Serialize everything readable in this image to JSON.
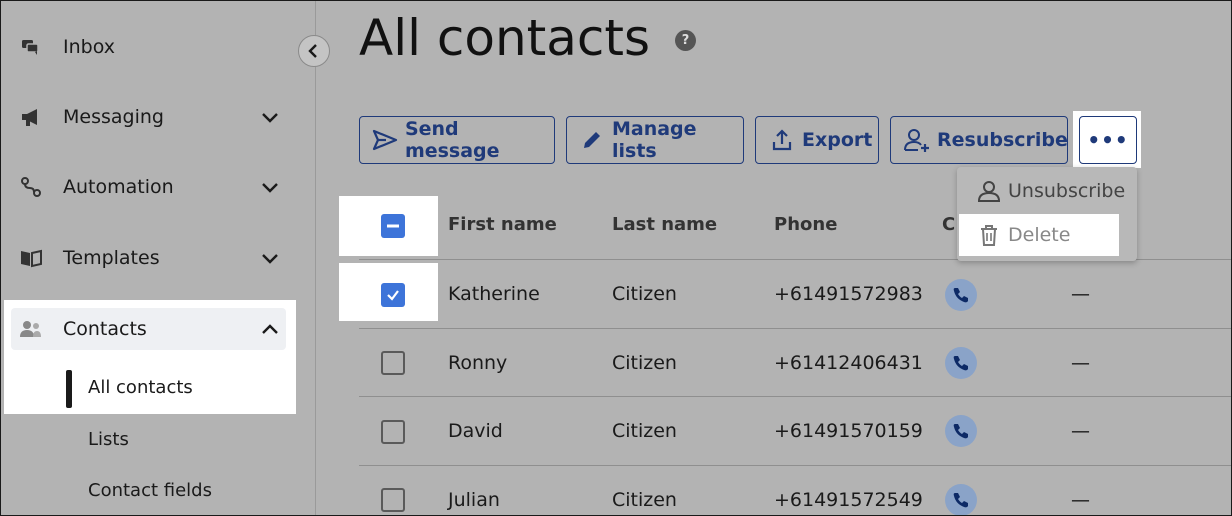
{
  "sidebar": {
    "items": [
      {
        "label": "Inbox",
        "icon": "chat-icon",
        "expandable": false
      },
      {
        "label": "Messaging",
        "icon": "megaphone-icon",
        "expandable": true
      },
      {
        "label": "Automation",
        "icon": "flow-icon",
        "expandable": true
      },
      {
        "label": "Templates",
        "icon": "book-icon",
        "expandable": true
      },
      {
        "label": "Contacts",
        "icon": "people-icon",
        "expandable": true,
        "expanded": true
      }
    ],
    "subitems": [
      {
        "label": "All contacts",
        "active": true
      },
      {
        "label": "Lists",
        "active": false
      },
      {
        "label": "Contact fields",
        "active": false
      }
    ],
    "collapse_icon": "chevron-left-icon"
  },
  "page": {
    "title": "All contacts",
    "help_glyph": "?"
  },
  "toolbar": {
    "send_message": "Send message",
    "manage_lists": "Manage lists",
    "export": "Export",
    "resubscribe": "Resubscribe",
    "more": "•••"
  },
  "dropdown": {
    "unsubscribe": "Unsubscribe",
    "delete": "Delete"
  },
  "table": {
    "headers": {
      "first_name": "First name",
      "last_name": "Last name",
      "phone": "Phone",
      "channel": "C"
    },
    "rows": [
      {
        "first": "Katherine",
        "last": "Citizen",
        "phone": "+61491572983",
        "extra": "—",
        "checked": true
      },
      {
        "first": "Ronny",
        "last": "Citizen",
        "phone": "+61412406431",
        "extra": "—",
        "checked": false
      },
      {
        "first": "David",
        "last": "Citizen",
        "phone": "+61491570159",
        "extra": "—",
        "checked": false
      },
      {
        "first": "Julian",
        "last": "Citizen",
        "phone": "+61491572549",
        "extra": "—",
        "checked": false
      }
    ]
  },
  "colors": {
    "accent": "#1f3a7a",
    "checkbox": "#3d74d9",
    "overlay": "#b3b3b3"
  }
}
